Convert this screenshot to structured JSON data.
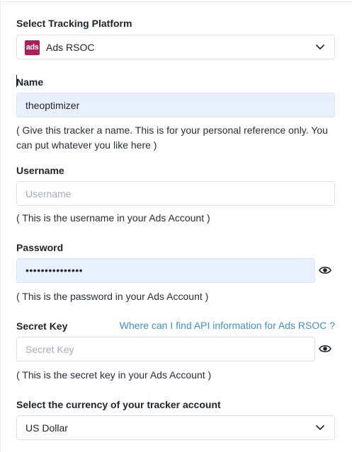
{
  "platform": {
    "label": "Select Tracking Platform",
    "logo_text": "ads",
    "value": "Ads RSOC",
    "icon": "chevron-down-icon"
  },
  "name": {
    "label": "Name",
    "value": "theoptimizer",
    "help": "( Give this tracker a name. This is for your personal reference only. You can put whatever you like here )"
  },
  "username": {
    "label": "Username",
    "placeholder": "Username",
    "help": "( This is the username in your Ads Account )"
  },
  "password": {
    "label": "Password",
    "value": "•••••••••••••••",
    "help": "( This is the password in your Ads Account )",
    "toggle_icon": "eye-icon"
  },
  "secret_key": {
    "label": "Secret Key",
    "placeholder": "Secret Key",
    "link": "Where can I find API information for Ads RSOC ?",
    "help": "( This is the secret key in your Ads Account )",
    "toggle_icon": "eye-icon"
  },
  "currency": {
    "label": "Select the currency of your tracker account",
    "value": "US Dollar",
    "icon": "chevron-down-icon"
  },
  "colors": {
    "accent_link": "#3d8ed6",
    "filled_input_bg": "#e8f0fe",
    "logo_bg": "#b01e58"
  }
}
